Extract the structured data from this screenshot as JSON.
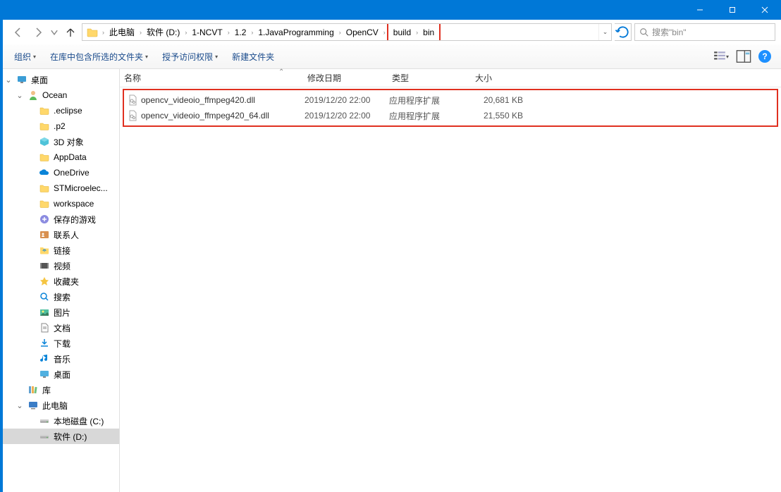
{
  "window_controls": {
    "min": "—",
    "max": "☐",
    "close": "✕"
  },
  "breadcrumb": [
    "此电脑",
    "软件 (D:)",
    "1-NCVT",
    "1.2",
    "1.JavaProgramming",
    "OpenCV",
    "build",
    "bin"
  ],
  "search_placeholder": "搜索\"bin\"",
  "toolbar": {
    "organize": "组织",
    "include": "在库中包含所选的文件夹",
    "share": "授予访问权限",
    "new_folder": "新建文件夹"
  },
  "columns": {
    "name": "名称",
    "date": "修改日期",
    "type": "类型",
    "size": "大小"
  },
  "files": [
    {
      "name": "opencv_videoio_ffmpeg420.dll",
      "date": "2019/12/20 22:00",
      "type": "应用程序扩展",
      "size": "20,681 KB"
    },
    {
      "name": "opencv_videoio_ffmpeg420_64.dll",
      "date": "2019/12/20 22:00",
      "type": "应用程序扩展",
      "size": "21,550 KB"
    }
  ],
  "tree": [
    {
      "label": "桌面",
      "indent": 0,
      "icon": "desktop",
      "expand": "open"
    },
    {
      "label": "Ocean",
      "indent": 1,
      "icon": "user",
      "expand": "open"
    },
    {
      "label": ".eclipse",
      "indent": 2,
      "icon": "folder"
    },
    {
      "label": ".p2",
      "indent": 2,
      "icon": "folder"
    },
    {
      "label": "3D 对象",
      "indent": 2,
      "icon": "3d"
    },
    {
      "label": "AppData",
      "indent": 2,
      "icon": "folder"
    },
    {
      "label": "OneDrive",
      "indent": 2,
      "icon": "onedrive"
    },
    {
      "label": "STMicroelec...",
      "indent": 2,
      "icon": "folder"
    },
    {
      "label": "workspace",
      "indent": 2,
      "icon": "folder"
    },
    {
      "label": "保存的游戏",
      "indent": 2,
      "icon": "games"
    },
    {
      "label": "联系人",
      "indent": 2,
      "icon": "contacts"
    },
    {
      "label": "链接",
      "indent": 2,
      "icon": "links"
    },
    {
      "label": "视频",
      "indent": 2,
      "icon": "video"
    },
    {
      "label": "收藏夹",
      "indent": 2,
      "icon": "fav"
    },
    {
      "label": "搜索",
      "indent": 2,
      "icon": "search"
    },
    {
      "label": "图片",
      "indent": 2,
      "icon": "pictures"
    },
    {
      "label": "文档",
      "indent": 2,
      "icon": "docs"
    },
    {
      "label": "下载",
      "indent": 2,
      "icon": "downloads"
    },
    {
      "label": "音乐",
      "indent": 2,
      "icon": "music"
    },
    {
      "label": "桌面",
      "indent": 2,
      "icon": "desktop2"
    },
    {
      "label": "库",
      "indent": 1,
      "icon": "libraries"
    },
    {
      "label": "此电脑",
      "indent": 1,
      "icon": "pc",
      "expand": "open"
    },
    {
      "label": "本地磁盘 (C:)",
      "indent": 2,
      "icon": "drive"
    },
    {
      "label": "软件 (D:)",
      "indent": 2,
      "icon": "drive",
      "selected": true
    }
  ]
}
